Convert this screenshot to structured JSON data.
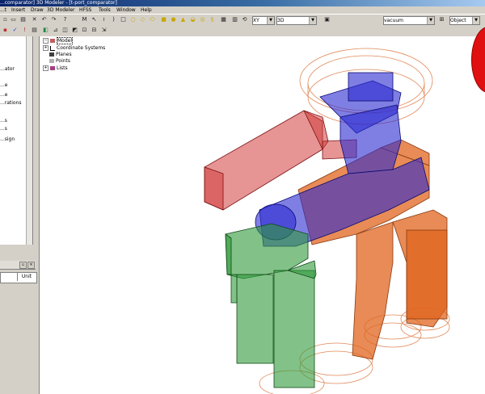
{
  "window": {
    "title": "...comparator] 3D Modeler - [t-port_comparator]",
    "title_color": "#0a246a"
  },
  "menu": [
    "...t",
    "Insert",
    "Draw",
    "3D Modeler",
    "HFSS",
    "Tools",
    "Window",
    "Help"
  ],
  "toolbar": {
    "plane_value": "XY",
    "mode_value": "3D",
    "material_value": "vacuum",
    "select_value": "Object"
  },
  "left_panel": {
    "items": [
      "...ator",
      "...e",
      "...e",
      "...rations",
      "...s",
      "...s",
      "...sign"
    ]
  },
  "properties_panel": {
    "unit_header": "Unit"
  },
  "tree": {
    "items": [
      "Model",
      "Coordinate Systems",
      "Planes",
      "Points",
      "Lists"
    ]
  },
  "colors": {
    "red_part": "#d23c3c",
    "blue_part": "#2a2ad0",
    "green_part": "#2f9a3a",
    "orange_part": "#e0641e",
    "wire_orange": "#e08858"
  },
  "icons": [
    "new-icon",
    "open-icon",
    "save-icon",
    "print-icon",
    "cut-icon",
    "undo-icon",
    "redo-icon",
    "draw-line-icon",
    "draw-arc-icon",
    "draw-rectangle-icon",
    "draw-circle-icon",
    "draw-box-icon",
    "draw-cylinder-icon",
    "pan-icon",
    "rotate-icon",
    "zoom-icon",
    "fit-icon",
    "material-icon",
    "close-icon"
  ]
}
